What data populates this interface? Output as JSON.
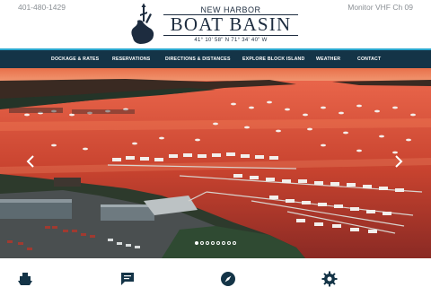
{
  "header": {
    "phone": "401-480-1429",
    "vhf": "Monitor VHF Ch 09",
    "logo_top": "NEW HARBOR",
    "logo_main": "BOAT BASIN",
    "logo_coords": "41° 10' 58\" N     71° 34' 40\" W"
  },
  "nav": {
    "items": [
      {
        "label": "Dockage & Rates"
      },
      {
        "label": "Reservations"
      },
      {
        "label": "Directions & Distances"
      },
      {
        "label": "Explore Block Island"
      },
      {
        "label": "Weather"
      },
      {
        "label": "Contact"
      }
    ]
  },
  "hero": {
    "slide_count": 8,
    "active_slide": 1,
    "prev_icon": "chevron-left-icon",
    "next_icon": "chevron-right-icon"
  },
  "features": {
    "icons": [
      "ferry-icon",
      "chat-icon",
      "compass-icon",
      "gear-icon"
    ]
  },
  "colors": {
    "nav_bg": "#143447",
    "nav_accent": "#2aa7cf",
    "logo_text": "#1d2c3f",
    "icon_color": "#143447"
  }
}
